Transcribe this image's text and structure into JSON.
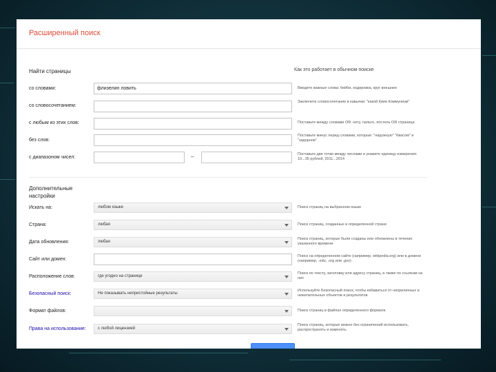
{
  "page": {
    "title": "Расширенный поиск",
    "find_pages_heading": "Найти страницы",
    "how_heading": "Как это работает в обычном поиске"
  },
  "find_rows": [
    {
      "label": "со словами:",
      "value": "флизелин ловить",
      "hint": "Введите важные слова: бейби, кодировка, круг внешнее"
    },
    {
      "label": "со словосочетанием:",
      "value": "",
      "hint": "Заключите словосочетание в кавычки: \"какой Киев Коммунизм\""
    },
    {
      "label": "с любым из этих слов:",
      "value": "",
      "hint": "Поставьте между словами OR: нету, пальто, постель OR страница"
    },
    {
      "label": "без слов:",
      "value": "",
      "hint": "Поставьте минус перед словами, которые: \"наружную\" \"Квасом\" и \"задорнов\""
    },
    {
      "label": "с диапазоном чисел:",
      "value": "",
      "value2": "",
      "separator": "–",
      "hint": "Поставьте две точки между числами и укажите единицу измерения: 10...35 рублей, 2011...2014"
    }
  ],
  "extra_heading": "Дополнительные настройки",
  "filter_rows": [
    {
      "label": "Искать на:",
      "value": "любом языке",
      "type": "select",
      "link": false,
      "hint": "Поиск страниц на выбранном языке"
    },
    {
      "label": "Страна:",
      "value": "любая",
      "type": "select",
      "link": false,
      "hint": "Поиск страниц, созданных в определенной стране"
    },
    {
      "label": "Дата обновления:",
      "value": "любая",
      "type": "select",
      "link": false,
      "hint": "Поиск страниц, которые были созданы или обновлены в течение указанного времени"
    },
    {
      "label": "Сайт или домен:",
      "value": "",
      "type": "input",
      "link": false,
      "hint": "Поиск на определенном сайте (например, wikipedia.org) или в домене (например, .edu, .org или .gov)"
    },
    {
      "label": "Расположение слов:",
      "value": "где угодно на странице",
      "type": "select",
      "link": false,
      "hint": "Поиск по тексту, заголовку или адресу страниц, а также по ссылкам на них"
    },
    {
      "label": "Безопасный поиск:",
      "value": "Не показывать непристойные результаты",
      "type": "select",
      "link": true,
      "hint": "Используйте Безопасный поиск, чтобы избавиться от неприличных и нежелательных объектов и результатов"
    },
    {
      "label": "Формат файлов:",
      "value": "",
      "type": "select",
      "link": false,
      "hint": "Поиск страниц в файлах определенного формата"
    },
    {
      "label": "Права на использование:",
      "value": "с любой лицензией",
      "type": "select",
      "link": true,
      "hint": "Поиск страниц, которые можно без ограничений использовать, распространять и изменять"
    }
  ],
  "colors": {
    "title": "#dd4b39",
    "link": "#1a0dab",
    "button": "#4d90fe"
  }
}
